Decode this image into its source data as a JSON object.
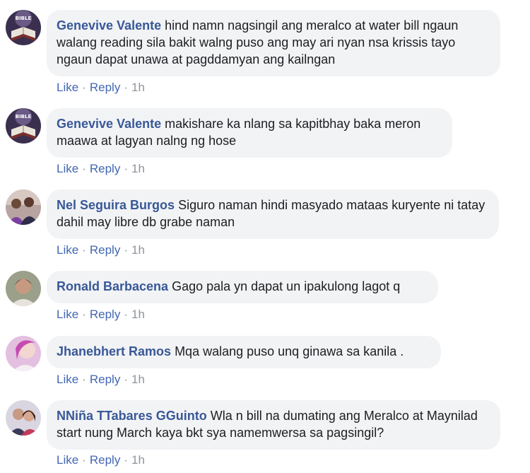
{
  "actions": {
    "like": "Like",
    "reply": "Reply",
    "separator": "·"
  },
  "comments": [
    {
      "author": "Genevive Valente",
      "text": "hind namn nagsingil ang meralco at water bill ngaun walang reading sila bakit walng puso ang may ari nyan nsa krissis tayo ngaun dapat unawa at pagddamyan ang kailngan",
      "time": "1h",
      "avatar": "bible-book-avatar"
    },
    {
      "author": "Genevive Valente",
      "text": "makishare ka nlang sa kapitbhay baka meron maawa at lagyan nalng ng hose",
      "time": "1h",
      "avatar": "bible-book-avatar"
    },
    {
      "author": "Nel Seguira Burgos",
      "text": "Siguro naman hindi masyado mataas kuryente ni tatay dahil may libre db grabe naman",
      "time": "1h",
      "avatar": "group-photo-avatar"
    },
    {
      "author": "Ronald Barbacena",
      "text": "Gago pala yn dapat un ipakulong lagot q",
      "time": "1h",
      "avatar": "person-photo-avatar"
    },
    {
      "author": "Jhanebhert Ramos",
      "text": "Mqa walang puso unq ginawa sa kanila .",
      "time": "1h",
      "avatar": "pink-portrait-avatar"
    },
    {
      "author": "NNiña TTabares GGuinto",
      "text": "Wla n bill na dumating ang Meralco at Maynilad start nung March kaya bkt sya namemwersa sa pagsingil?",
      "time": "1h",
      "avatar": "couple-photo-avatar"
    }
  ],
  "colors": {
    "author": "#385898",
    "bubble": "#f2f3f5",
    "action_link": "#4267b2",
    "time": "#90949c"
  }
}
